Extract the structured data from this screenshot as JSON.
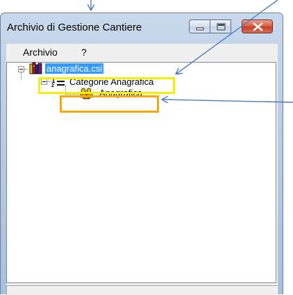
{
  "window": {
    "title": "Archivio di Gestione Cantiere",
    "controls": {
      "minimize": "minimize-icon",
      "maximize": "maximize-icon",
      "close": "close-icon"
    }
  },
  "menu": {
    "items": [
      {
        "label": "Archivio"
      },
      {
        "label": "?"
      }
    ]
  },
  "tree": {
    "root": {
      "label": "anagrafica.csi",
      "icon": "books-icon",
      "selected": true
    },
    "category": {
      "label": "Categorie Anagrafica",
      "icon": "numbering-icon"
    },
    "leaf": {
      "label": "Anagrafica",
      "icon": "people-group-icon"
    }
  },
  "annotations": {
    "arrow_color": "#4a7ebb",
    "highlight_yellow": "#f5f00a",
    "highlight_orange": "#f5a80a"
  },
  "colors": {
    "selection": "#3399ff",
    "close_button": "#c4412a"
  }
}
